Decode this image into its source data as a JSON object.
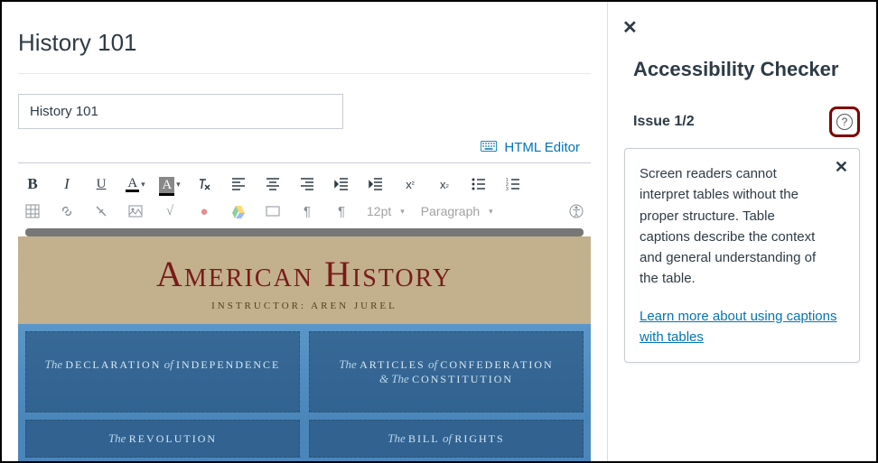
{
  "page": {
    "title": "History 101",
    "title_input_value": "History 101"
  },
  "editor": {
    "html_editor_label": "HTML Editor",
    "font_size": "12pt",
    "paragraph_style": "Paragraph"
  },
  "content": {
    "banner_title": "American History",
    "instructor_line": "INSTRUCTOR: AREN JUREL",
    "tiles": [
      {
        "pre": "The",
        "main": "DECLARATION",
        "mid": "of",
        "post": "INDEPENDENCE"
      },
      {
        "pre": "The",
        "main": "ARTICLES",
        "mid": "of",
        "post": "CONFEDERATION",
        "line2_pre": "& The",
        "line2_main": "CONSTITUTION"
      }
    ],
    "tiles2": [
      {
        "pre": "The",
        "main": "REVOLUTION"
      },
      {
        "pre": "The",
        "main": "BILL",
        "mid": "of",
        "post": "RIGHTS"
      }
    ]
  },
  "panel": {
    "title": "Accessibility Checker",
    "issue_label": "Issue 1/2",
    "issue_current": 1,
    "issue_total": 2,
    "description": "Screen readers cannot interpret tables without the proper structure. Table captions describe the context and general understanding of the table.",
    "link_text": "Learn more about using captions with tables"
  }
}
